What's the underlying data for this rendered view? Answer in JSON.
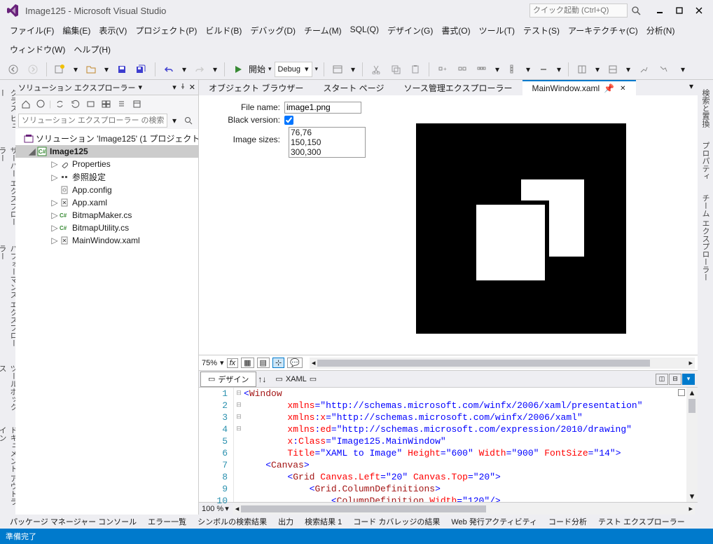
{
  "titlebar": {
    "title": "Image125 - Microsoft Visual Studio",
    "launch_placeholder": "クイック起動 (Ctrl+Q)"
  },
  "menu": {
    "file": "ファイル(F)",
    "edit": "編集(E)",
    "view": "表示(V)",
    "project": "プロジェクト(P)",
    "build": "ビルド(B)",
    "debug": "デバッグ(D)",
    "team": "チーム(M)",
    "sql": "SQL(Q)",
    "design": "デザイン(G)",
    "format": "書式(O)",
    "tools": "ツール(T)",
    "test": "テスト(S)",
    "arch": "アーキテクチャ(C)",
    "analyze": "分析(N)",
    "window": "ウィンドウ(W)",
    "help": "ヘルプ(H)"
  },
  "toolbar": {
    "start": "開始",
    "config": "Debug"
  },
  "sidetabs_left": [
    "クラス ビュー",
    "サーバー エクスプローラー",
    "パフォーマンス エクスプローラー",
    "ツールボックス",
    "ドキュメント アウトライン"
  ],
  "sidetabs_right": [
    "検索と置換",
    "プロパティ",
    "チーム エクスプローラー"
  ],
  "solution": {
    "title": "ソリューション エクスプローラー",
    "search_placeholder": "ソリューション エクスプローラー の検索 (Ctrl+",
    "root": "ソリューション 'Image125' (1 プロジェクト)",
    "project": "Image125",
    "items": [
      "Properties",
      "参照設定",
      "App.config",
      "App.xaml",
      "BitmapMaker.cs",
      "BitmapUtility.cs",
      "MainWindow.xaml"
    ]
  },
  "doctabs": {
    "t1": "オブジェクト ブラウザー",
    "t2": "スタート ページ",
    "t3": "ソース管理エクスプローラー",
    "active": "MainWindow.xaml"
  },
  "form": {
    "filename_label": "File name:",
    "filename_value": "image1.png",
    "blackv_label": "Black version:",
    "sizes_label": "Image sizes:",
    "sizes": [
      "76,76",
      "150,150",
      "300,300"
    ]
  },
  "designer_footer": {
    "zoom": "75%"
  },
  "splittabs": {
    "design": "デザイン",
    "xaml": "XAML"
  },
  "code": {
    "lines": [
      1,
      2,
      3,
      4,
      5,
      6,
      7,
      8,
      9,
      10
    ]
  },
  "codefooter": {
    "zoom": "100 %"
  },
  "bottomtabs": [
    "パッケージ マネージャー コンソール",
    "エラー一覧",
    "シンボルの検索結果",
    "出力",
    "検索結果 1",
    "コード カバレッジの結果",
    "Web 発行アクティビティ",
    "コード分析",
    "テスト エクスプローラー"
  ],
  "statusbar": {
    "ready": "準備完了"
  }
}
